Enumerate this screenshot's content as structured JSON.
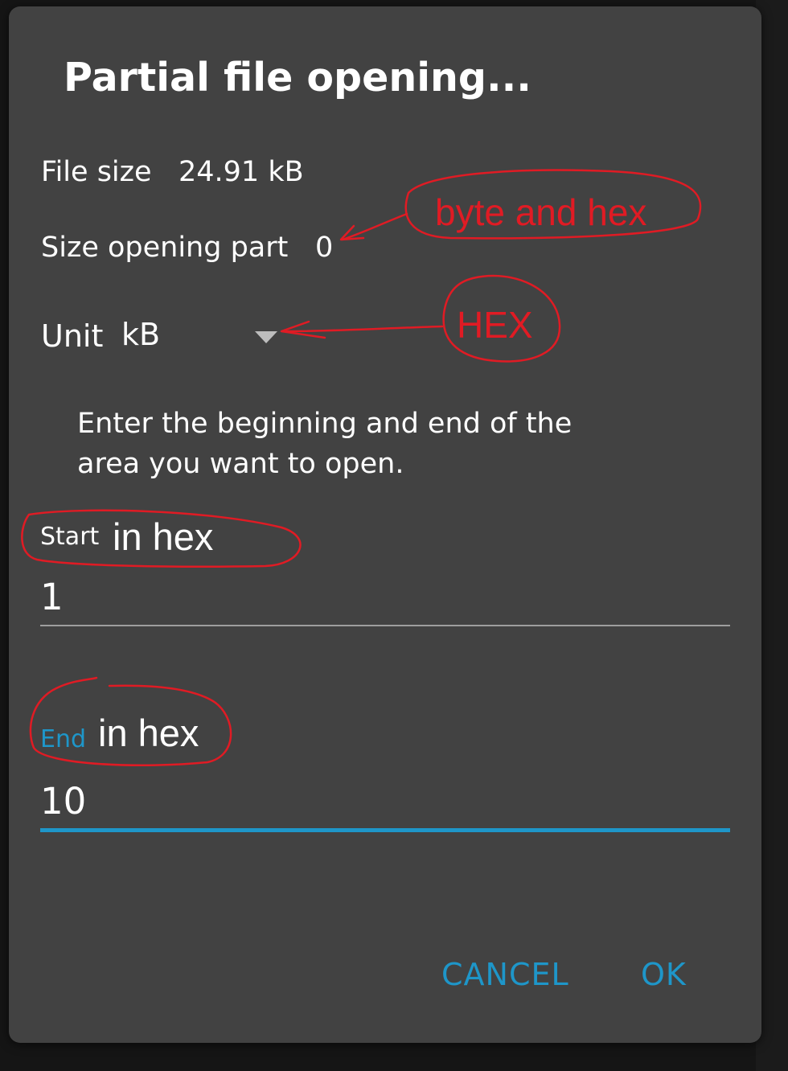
{
  "dialog": {
    "title": "Partial file opening...",
    "file_size_label": "File size",
    "file_size_value": "24.91 kB",
    "size_opening_label": "Size opening part",
    "size_opening_value": "0",
    "unit_label": "Unit",
    "unit_selected": "kB",
    "hint": "Enter the beginning and end of the area you want to open.",
    "start_field": {
      "label": "Start",
      "value": "1"
    },
    "end_field": {
      "label": "End",
      "value": "10"
    },
    "buttons": {
      "cancel": "CANCEL",
      "ok": "OK"
    }
  },
  "annotations": {
    "byte_and_hex": "byte and hex",
    "hex": "HEX",
    "start_in_hex": "in hex",
    "end_in_hex": "in hex"
  },
  "colors": {
    "dialog_bg": "#424242",
    "accent": "#1e96c9",
    "annotation_red": "#e01b24",
    "text": "#ffffff"
  },
  "icons": {
    "unit_dropdown": "triangle-down-icon"
  }
}
